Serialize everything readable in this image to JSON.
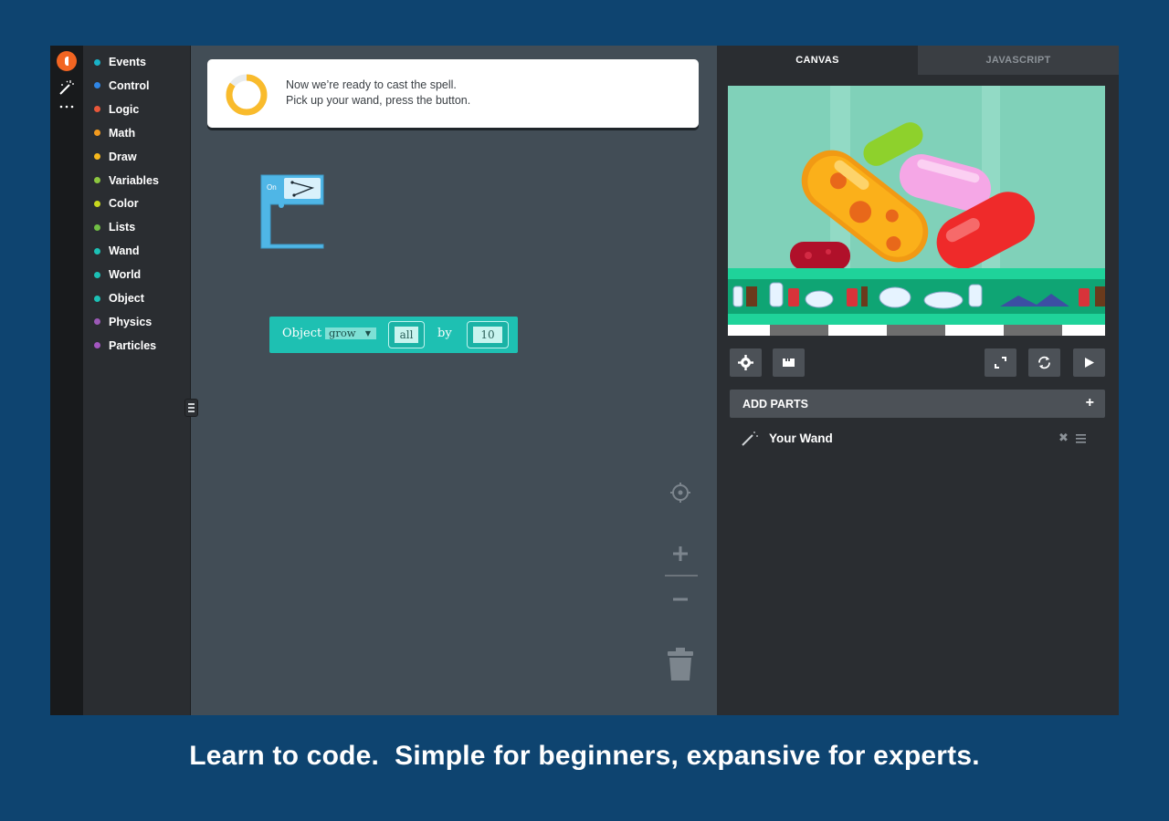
{
  "rail": {
    "icons": [
      "logo-icon",
      "wand-icon",
      "more-icon"
    ]
  },
  "categories": [
    {
      "label": "Events",
      "color": "#19b2c7"
    },
    {
      "label": "Control",
      "color": "#2f86e6"
    },
    {
      "label": "Logic",
      "color": "#e8573a"
    },
    {
      "label": "Math",
      "color": "#f29a1f"
    },
    {
      "label": "Draw",
      "color": "#f6b81c"
    },
    {
      "label": "Variables",
      "color": "#8cc63f"
    },
    {
      "label": "Color",
      "color": "#c8d81e"
    },
    {
      "label": "Lists",
      "color": "#70be44"
    },
    {
      "label": "Wand",
      "color": "#1cc0b5"
    },
    {
      "label": "World",
      "color": "#1cc0b5"
    },
    {
      "label": "Object",
      "color": "#1cc0b5"
    },
    {
      "label": "Physics",
      "color": "#9b59b6"
    },
    {
      "label": "Particles",
      "color": "#a356c0"
    }
  ],
  "hint": {
    "line1": "Now we’re ready to cast the spell.",
    "line2": "Pick up your wand, press the button.",
    "progress": 0.85,
    "progress_color": "#f9bb2c"
  },
  "blocks": {
    "on_block": {
      "label": "On",
      "color": "#4fb6e6"
    },
    "object_block": {
      "label": "Object",
      "dropdown": "grow",
      "arg1": "all",
      "by": "by",
      "arg2": "10",
      "color": "#1ec0b2"
    }
  },
  "workspace_tools": [
    "recenter-icon",
    "zoom-in-icon",
    "zoom-out-icon",
    "trash-icon"
  ],
  "right_panel": {
    "tabs": [
      {
        "label": "CANVAS",
        "active": true
      },
      {
        "label": "JAVASCRIPT",
        "active": false
      }
    ],
    "toolbar": [
      "settings-icon",
      "save-icon",
      "fullscreen-icon",
      "restart-icon",
      "play-icon"
    ],
    "add_parts_label": "ADD PARTS",
    "parts": [
      {
        "name": "Your Wand",
        "icon": "wand-icon"
      }
    ]
  },
  "tagline": "Learn to code.  Simple for beginners, expansive for experts."
}
